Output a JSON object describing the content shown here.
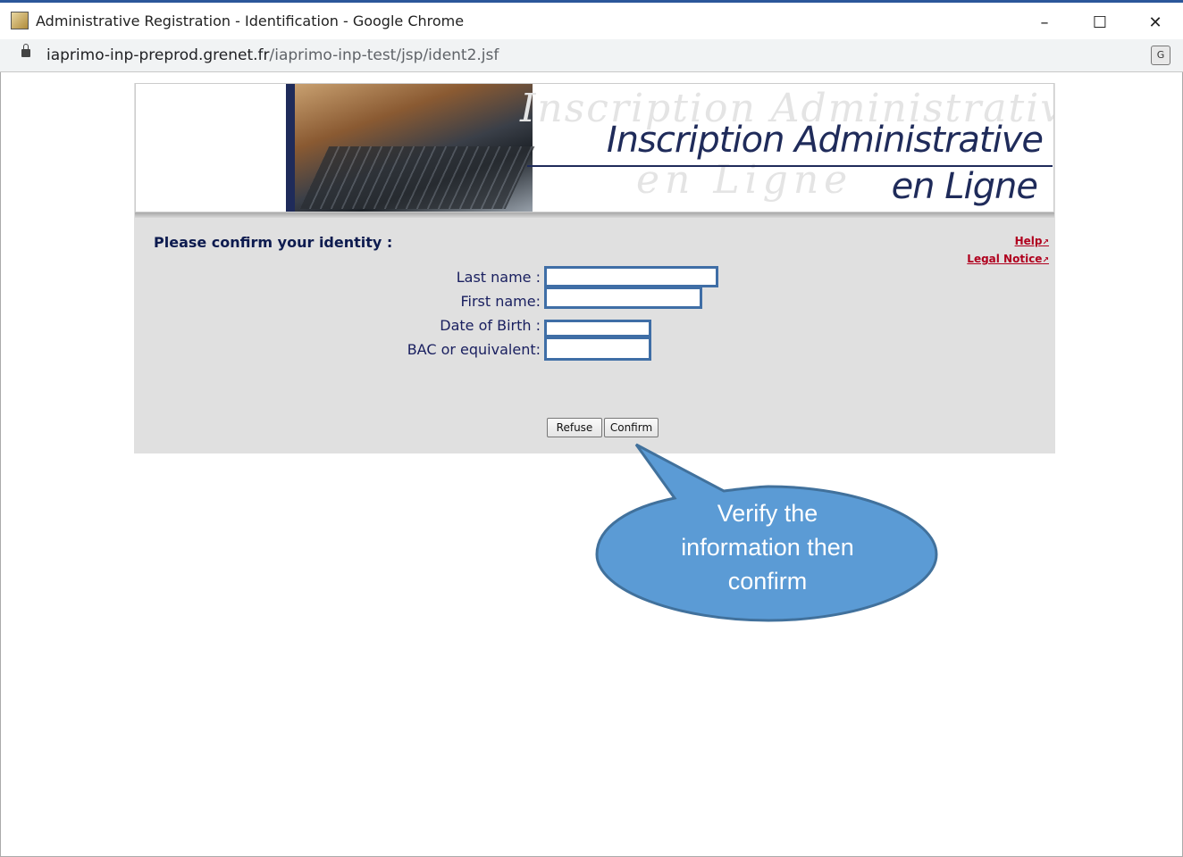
{
  "window": {
    "title": "Administrative Registration - Identification - Google Chrome",
    "minimize": "–",
    "maximize": "☐",
    "close": "✕"
  },
  "address": {
    "host": "iaprimo-inp-preprod.grenet.fr",
    "path": "/iaprimo-inp-test/jsp/ident2.jsf"
  },
  "banner": {
    "line1": "Inscription Administrative",
    "line2": "en Ligne",
    "ghost1": "Inscription Administrative",
    "ghost2": "en Ligne"
  },
  "form": {
    "heading": "Please confirm your identity :",
    "help_link": "Help",
    "legal_link": "Legal Notice",
    "fields": [
      {
        "label": "Last name :",
        "value": ""
      },
      {
        "label": "First name:",
        "value": ""
      },
      {
        "label": "Date of Birth :",
        "value": ""
      },
      {
        "label": "BAC or equivalent:",
        "value": ""
      }
    ],
    "refuse_label": "Refuse",
    "confirm_label": "Confirm"
  },
  "callout": {
    "text_line1": "Verify the",
    "text_line2": "information then",
    "text_line3": "confirm",
    "fill": "#5b9bd5",
    "stroke": "#41719c"
  }
}
